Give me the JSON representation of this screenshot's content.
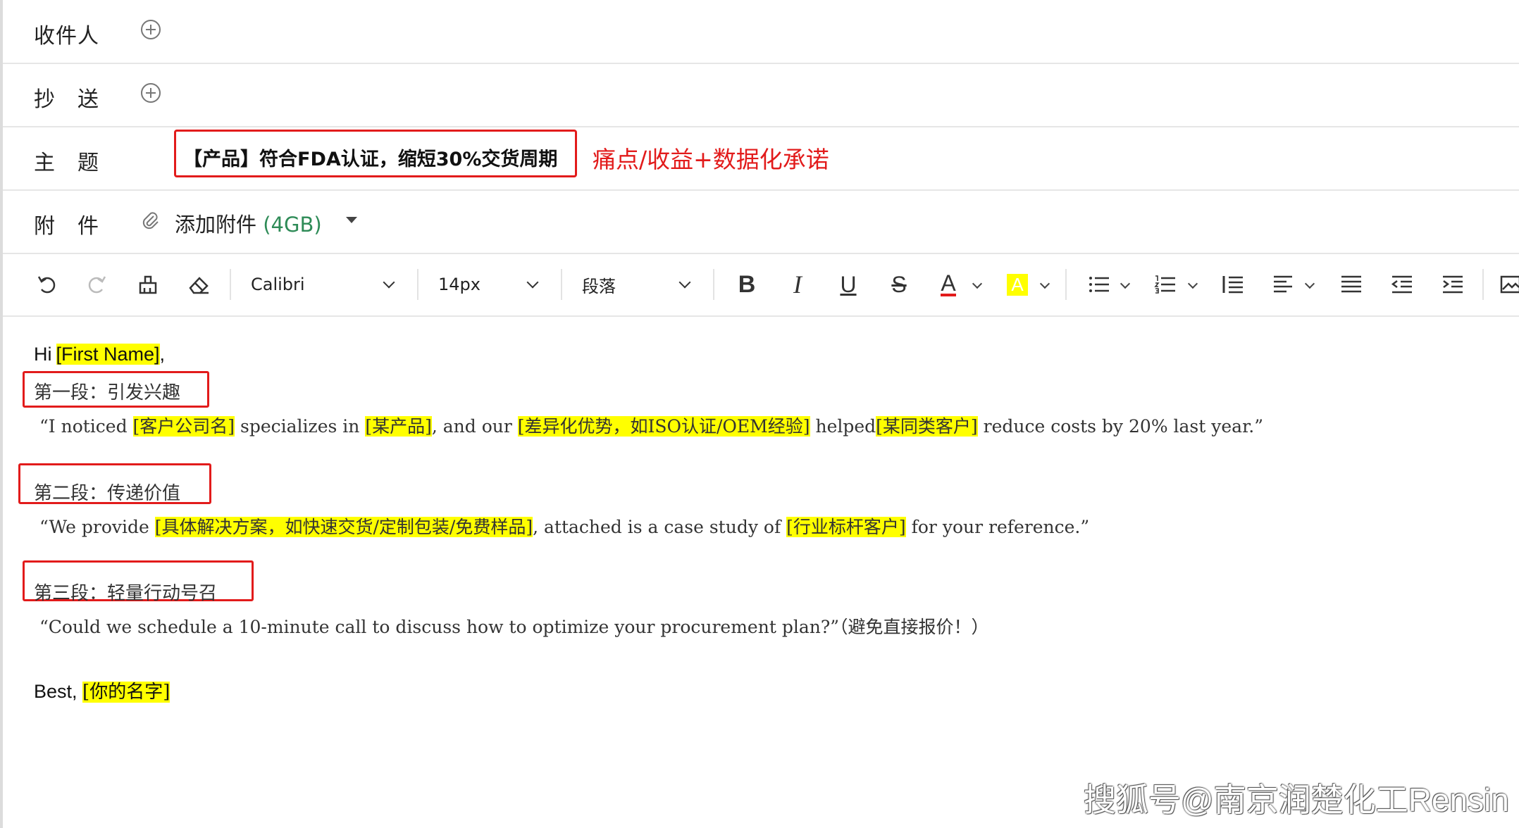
{
  "header": {
    "to_label": "收件人",
    "cc_label": "抄　送",
    "subject_label": "主　题",
    "subject_value": "【产品】符合FDA认证，缩短30%交货周期",
    "subject_annotation": "痛点/收益+数据化承诺",
    "attach_label": "附　件",
    "attach_action": "添加附件",
    "attach_size": "(4GB)"
  },
  "toolbar": {
    "font": "Calibri",
    "size": "14px",
    "paragraph": "段落",
    "bold": "B",
    "italic": "I",
    "underline": "U",
    "strike": "S",
    "font_color": "A",
    "highlight": "A"
  },
  "body": {
    "greeting": {
      "hi": "Hi",
      "name": "[First Name]",
      "comma": ","
    },
    "para1": {
      "label": "第一段：引发兴趣",
      "parts": [
        "“I noticed ",
        "[客户公司名]",
        " specializes in ",
        "[某产品]",
        ", and our ",
        "[差异化优势，如ISO认证/OEM经验]",
        " helped",
        "[某同类客户]",
        " reduce costs by 20% last year.”"
      ]
    },
    "para2": {
      "label": "第二段：传递价值",
      "parts": [
        "“We provide ",
        "[具体解决方案，如快速交货/定制包装/免费样品]",
        ", attached is a case study of ",
        "[行业标杆客户]",
        " for your reference.”"
      ]
    },
    "para3": {
      "label": "第三段：轻量行动号召",
      "text": "“Could we schedule a 10-minute call to discuss how to optimize your procurement plan?”（避免直接报价！）"
    },
    "signoff": {
      "best": "Best,",
      "name": "[你的名字]"
    }
  },
  "watermark": "搜狐号@南京润楚化工Rensin",
  "colors": {
    "annotation_red": "#e21b1b",
    "highlight": "#ffff00",
    "attach_size_green": "#2e8b57"
  }
}
